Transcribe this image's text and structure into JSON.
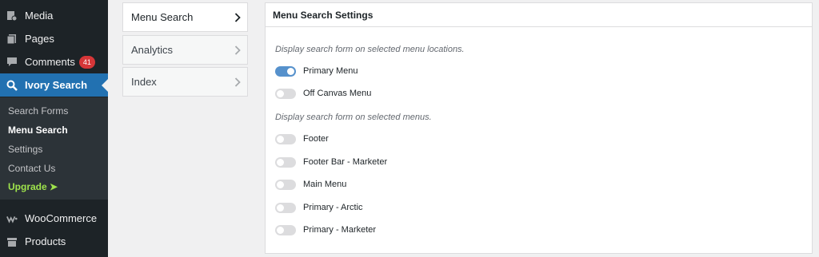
{
  "sidebar": {
    "media": "Media",
    "pages": "Pages",
    "comments": "Comments",
    "comments_count": "41",
    "ivory_search": "Ivory Search",
    "submenu": [
      "Search Forms",
      "Menu Search",
      "Settings",
      "Contact Us",
      "Upgrade ➤"
    ],
    "woocommerce": "WooCommerce",
    "products": "Products"
  },
  "tabs": [
    {
      "label": "Menu Search",
      "active": true
    },
    {
      "label": "Analytics",
      "active": false
    },
    {
      "label": "Index",
      "active": false
    }
  ],
  "panel": {
    "title": "Menu Search Settings",
    "locations_desc": "Display search form on selected menu locations.",
    "locations": [
      {
        "label": "Primary Menu",
        "on": true
      },
      {
        "label": "Off Canvas Menu",
        "on": false
      }
    ],
    "menus_desc": "Display search form on selected menus.",
    "menus": [
      {
        "label": "Footer",
        "on": false
      },
      {
        "label": "Footer Bar - Marketer",
        "on": false
      },
      {
        "label": "Main Menu",
        "on": false
      },
      {
        "label": "Primary - Arctic",
        "on": false
      },
      {
        "label": "Primary - Marketer",
        "on": false
      }
    ]
  },
  "colors": {
    "sidebar_bg": "#1d2327",
    "accent": "#2271b1",
    "toggle_on": "#5691cc",
    "upgrade": "#9fe44c",
    "badge": "#d63638"
  }
}
